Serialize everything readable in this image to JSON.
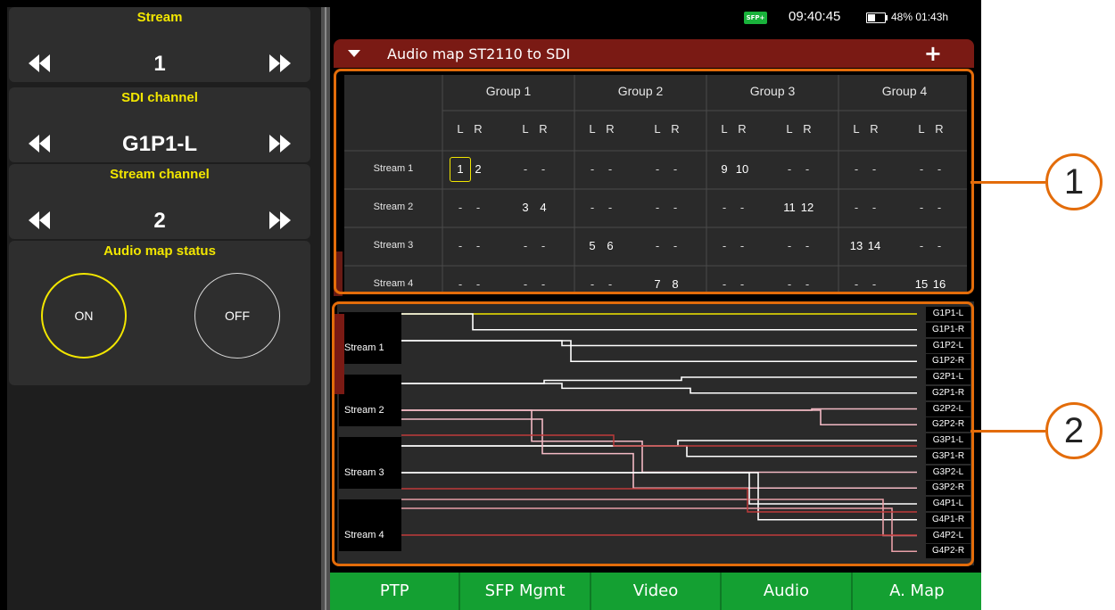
{
  "left_panel": {
    "stream": {
      "title": "Stream",
      "value": "1"
    },
    "sdi_channel": {
      "title": "SDI channel",
      "value": "G1P1-L"
    },
    "stream_channel": {
      "title": "Stream channel",
      "value": "2"
    },
    "audio_map_status": {
      "title": "Audio map status",
      "on_label": "ON",
      "off_label": "OFF",
      "selected": "ON"
    }
  },
  "status_bar": {
    "sfp_badge": "SFP+",
    "time": "09:40:45",
    "battery": "48% 01:43h",
    "battery_level": 0.48
  },
  "panel": {
    "title": "Audio map ST2110 to SDI",
    "add_icon": "plus-icon",
    "collapse_icon": "triangle-down-icon"
  },
  "matrix": {
    "groups": [
      "Group 1",
      "Group 2",
      "Group 3",
      "Group 4"
    ],
    "channel_labels": [
      "L",
      "R",
      "L",
      "R",
      "L",
      "R",
      "L",
      "R",
      "L",
      "R",
      "L",
      "R",
      "L",
      "R",
      "L",
      "R"
    ],
    "rows": [
      {
        "label": "Stream 1",
        "cells": [
          "1",
          "2",
          "-",
          "-",
          "-",
          "-",
          "-",
          "-",
          "9",
          "10",
          "-",
          "-",
          "-",
          "-",
          "-",
          "-"
        ]
      },
      {
        "label": "Stream 2",
        "cells": [
          "-",
          "-",
          "3",
          "4",
          "-",
          "-",
          "-",
          "-",
          "-",
          "-",
          "11",
          "12",
          "-",
          "-",
          "-",
          "-"
        ]
      },
      {
        "label": "Stream 3",
        "cells": [
          "-",
          "-",
          "-",
          "-",
          "5",
          "6",
          "-",
          "-",
          "-",
          "-",
          "-",
          "-",
          "13",
          "14",
          "-",
          "-"
        ]
      },
      {
        "label": "Stream 4",
        "cells": [
          "-",
          "-",
          "-",
          "-",
          "-",
          "-",
          "7",
          "8",
          "-",
          "-",
          "-",
          "-",
          "-",
          "-",
          "15",
          "16"
        ]
      }
    ],
    "selected_cell": {
      "row": 0,
      "col": 0
    }
  },
  "routing": {
    "streams": [
      "Stream 1",
      "Stream 2",
      "Stream 3",
      "Stream 4"
    ],
    "destinations": [
      "G1P1-L",
      "G1P1-R",
      "G1P2-L",
      "G1P2-R",
      "G2P1-L",
      "G2P1-R",
      "G2P2-L",
      "G2P2-R",
      "G3P1-L",
      "G3P1-R",
      "G3P2-L",
      "G3P2-R",
      "G4P1-L",
      "G4P1-R",
      "G4P2-L",
      "G4P2-R"
    ],
    "colors": {
      "selected": "#f2e600",
      "stream1": "#ffffff",
      "stream2": "#f2b9c4",
      "stream3": "#ffffff",
      "stream4": "#e8a0a8",
      "red": "#c03a3a"
    }
  },
  "tabs": [
    "PTP",
    "SFP Mgmt",
    "Video",
    "Audio",
    "A. Map"
  ],
  "callouts": [
    "1",
    "2"
  ],
  "colors": {
    "accent": "#f2e600",
    "header": "#7a1a14",
    "tab_green": "#14a032",
    "annotation": "#e36c0a"
  }
}
